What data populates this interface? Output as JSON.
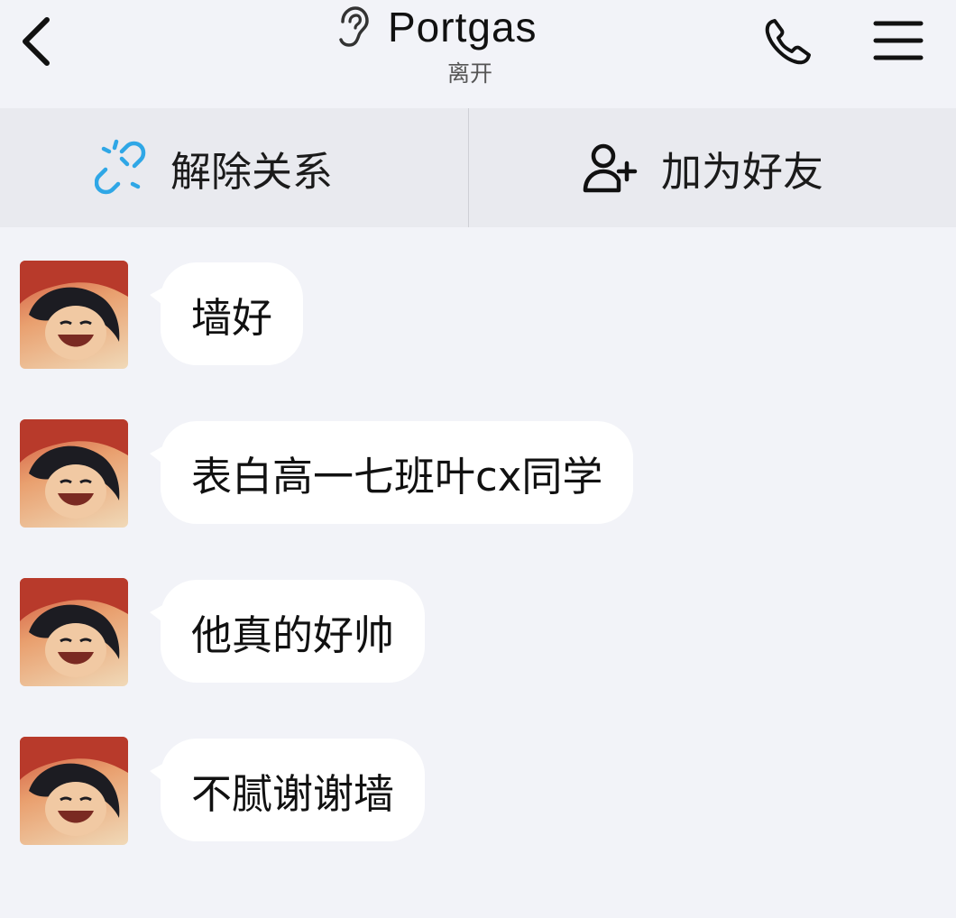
{
  "header": {
    "title": "Portgas",
    "status": "离开",
    "icons": [
      "back-icon",
      "ear-icon",
      "phone-icon",
      "menu-icon"
    ]
  },
  "actions": {
    "unlink_label": "解除关系",
    "add_friend_label": "加为好友",
    "unlink_icon_color": "#2fa7e6"
  },
  "messages": [
    {
      "text": "墙好"
    },
    {
      "text": "表白高一七班叶cx同学"
    },
    {
      "text": "他真的好帅"
    },
    {
      "text": "不腻谢谢墙"
    }
  ],
  "colors": {
    "background": "#f2f3f8",
    "action_bar": "#e9eaef",
    "bubble": "#ffffff"
  }
}
